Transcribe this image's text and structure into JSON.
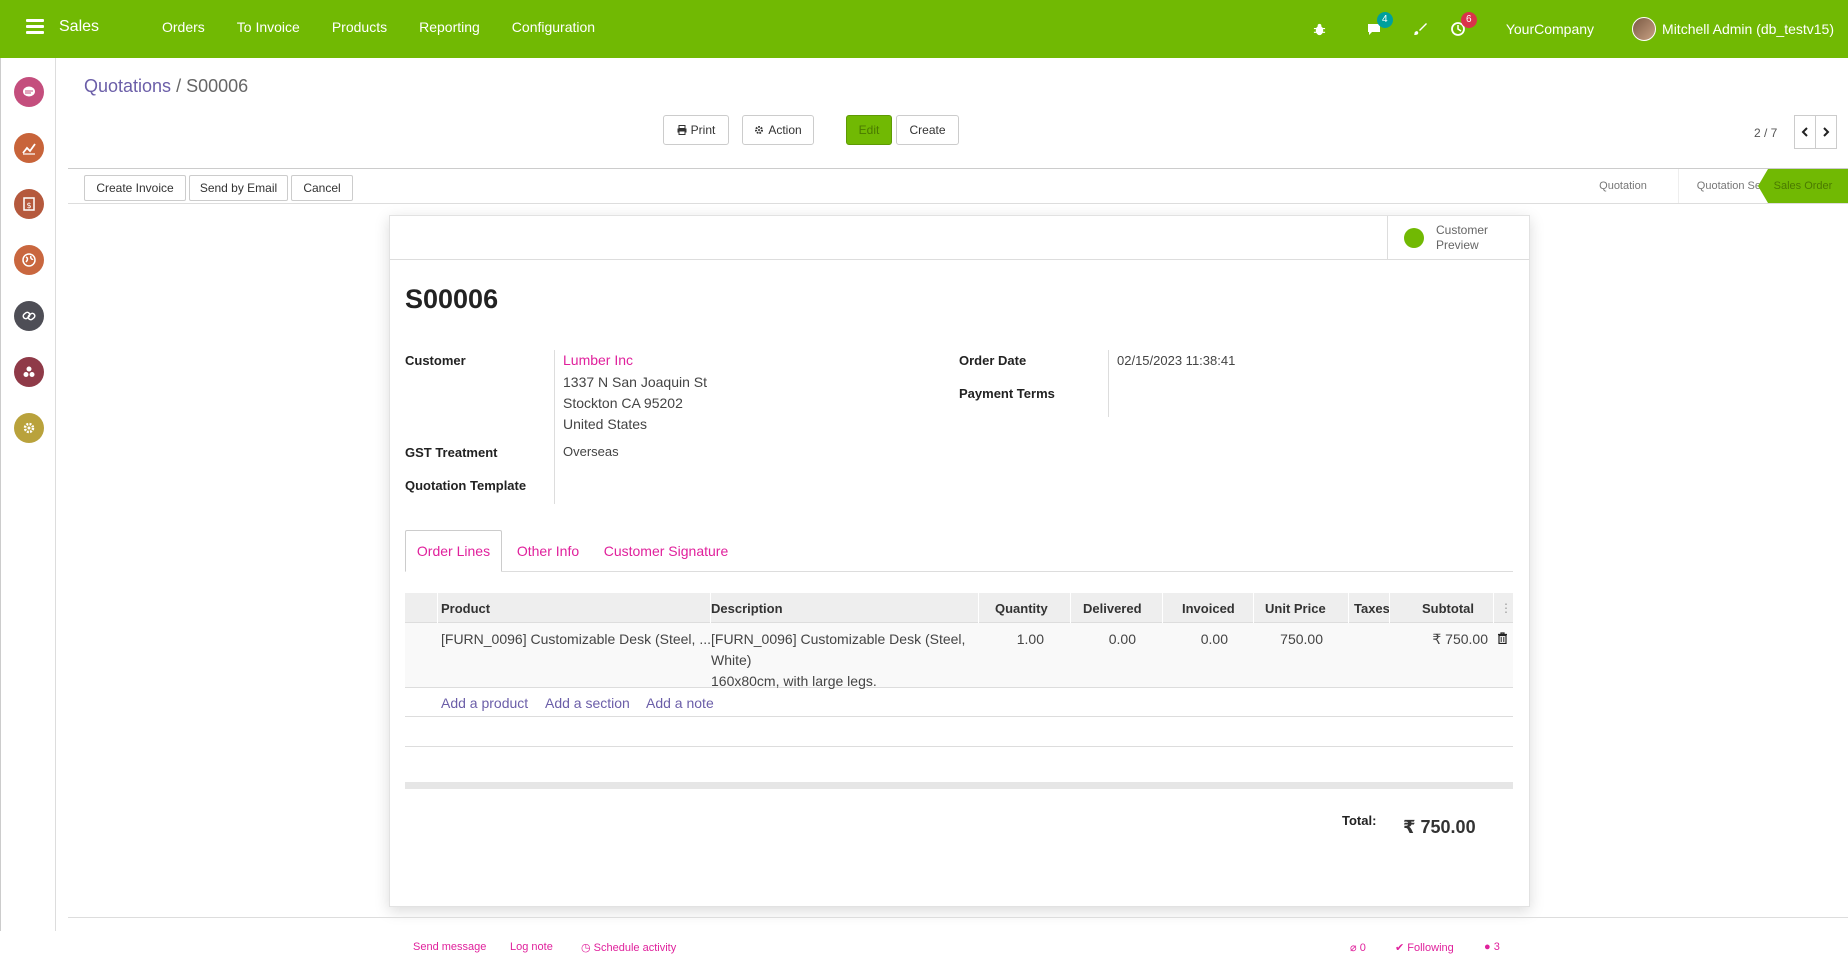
{
  "navbar": {
    "app_name": "Sales",
    "menu": [
      "Orders",
      "To Invoice",
      "Products",
      "Reporting",
      "Configuration"
    ],
    "messages_count": "4",
    "activities_count": "6",
    "company": "YourCompany",
    "user": "Mitchell Admin (db_testv15)",
    "accent": "#71b903"
  },
  "sidebar": {
    "icons": [
      "chat-icon",
      "chart-icon",
      "invoice-icon",
      "globe-icon",
      "link-icon",
      "apps-icon",
      "settings-icon"
    ]
  },
  "breadcrumb": {
    "parent": "Quotations",
    "separator": "/",
    "current": "S00006"
  },
  "toolbar": {
    "print": "Print",
    "action": "Action",
    "edit": "Edit",
    "create": "Create",
    "pager": "2 / 7"
  },
  "statusbar": {
    "buttons": [
      "Create Invoice",
      "Send by Email",
      "Cancel"
    ],
    "stages": [
      "Quotation",
      "Quotation Sent",
      "Sales Order"
    ],
    "active_stage": "Sales Order"
  },
  "sheet": {
    "preview_line1": "Customer",
    "preview_line2": "Preview",
    "name": "S00006",
    "customer_label": "Customer",
    "customer_name": "Lumber Inc",
    "address_line1": "1337 N San Joaquin St",
    "address_line2": "Stockton CA 95202",
    "address_line3": "United States",
    "gst_label": "GST Treatment",
    "gst_value": "Overseas",
    "template_label": "Quotation Template",
    "order_date_label": "Order Date",
    "order_date_value": "02/15/2023 11:38:41",
    "payment_terms_label": "Payment Terms"
  },
  "tabs": [
    "Order Lines",
    "Other Info",
    "Customer Signature"
  ],
  "table": {
    "headers": [
      "Product",
      "Description",
      "Quantity",
      "Delivered",
      "Invoiced",
      "Unit Price",
      "Taxes",
      "Subtotal"
    ],
    "rows": [
      {
        "product": "[FURN_0096] Customizable Desk (Steel, ...",
        "description1": "[FURN_0096] Customizable Desk (Steel,",
        "description2": "White)",
        "description3": "160x80cm, with large legs.",
        "quantity": "1.00",
        "delivered": "0.00",
        "invoiced": "0.00",
        "unit_price": "750.00",
        "taxes": "",
        "subtotal": "₹ 750.00"
      }
    ],
    "add_product": "Add a product",
    "add_section": "Add a section",
    "add_note": "Add a note"
  },
  "totals": {
    "label": "Total:",
    "value": "₹ 750.00"
  },
  "chatter": {
    "send_message": "Send message",
    "log_note": "Log note",
    "schedule_activity": "Schedule activity",
    "attachments": "0",
    "following": "Following",
    "followers": "3"
  }
}
